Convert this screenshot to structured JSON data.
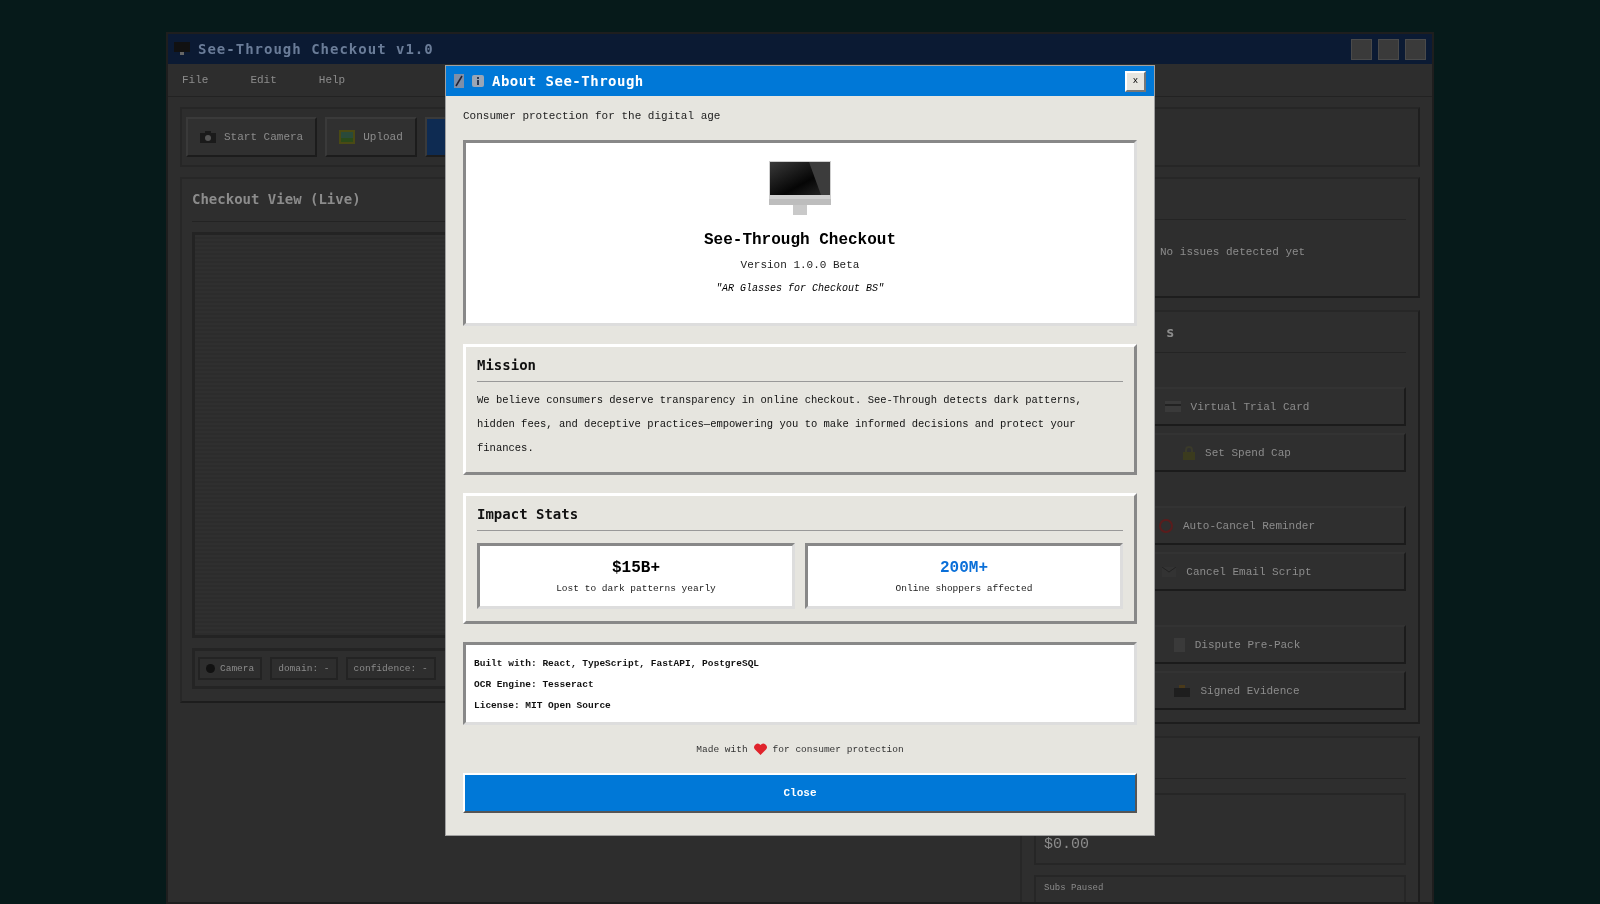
{
  "window": {
    "title": "See-Through Checkout v1.0"
  },
  "menu": [
    {
      "label": "File"
    },
    {
      "label": "Edit"
    },
    {
      "label": "Help"
    }
  ],
  "toolbar": [
    {
      "kind": "default",
      "label": "Start Camera"
    },
    {
      "kind": "default",
      "label": "Upload"
    },
    {
      "kind": "primary"
    }
  ],
  "checkout_view": {
    "title": "Checkout View (Live)",
    "status": [
      {
        "kind": "dot",
        "on": false,
        "label": "Camera"
      },
      {
        "kind": "text",
        "label": "domain: -"
      },
      {
        "kind": "text",
        "label": "confidence: -"
      }
    ]
  },
  "issues_panel": {
    "message": "No issues detected yet"
  },
  "actions_panel": {
    "title": "s",
    "groups": [
      [
        {
          "label": "Virtual Trial Card"
        },
        {
          "label": "Set Spend Cap"
        }
      ],
      [
        {
          "label": "Auto-Cancel Reminder"
        },
        {
          "label": "Cancel Email Script"
        }
      ],
      [
        {
          "label": "Dispute Pre-Pack"
        },
        {
          "label": "Signed Evidence"
        }
      ]
    ]
  },
  "savings_panel": {
    "amount": "$0.00",
    "label": "Subs Paused"
  },
  "dialog": {
    "title": "About See-Through",
    "subtitle": "Consumer protection for the digital age",
    "product": {
      "name": "See-Through Checkout",
      "version": "Version 1.0.0 Beta",
      "tagline": "\"AR Glasses for Checkout BS\""
    },
    "mission": {
      "title": "Mission",
      "text": "We believe consumers deserve transparency in online checkout. See-Through detects dark patterns, hidden fees, and deceptive practices—empowering you to make informed decisions and protect your finances."
    },
    "impact": {
      "title": "Impact Stats",
      "stats": [
        {
          "value": "$15B+",
          "label": "Lost to dark patterns yearly",
          "color": "#000000"
        },
        {
          "value": "200M+",
          "label": "Online shoppers affected",
          "color": "#0a6fd8"
        }
      ]
    },
    "info": [
      "Built with: React, TypeScript, FastAPI, PostgreSQL",
      "OCR Engine: Tesseract",
      "License: MIT Open Source"
    ],
    "footer": {
      "before": "Made with",
      "after": "for consumer protection"
    },
    "close_label": "Close",
    "close_x": "x"
  }
}
